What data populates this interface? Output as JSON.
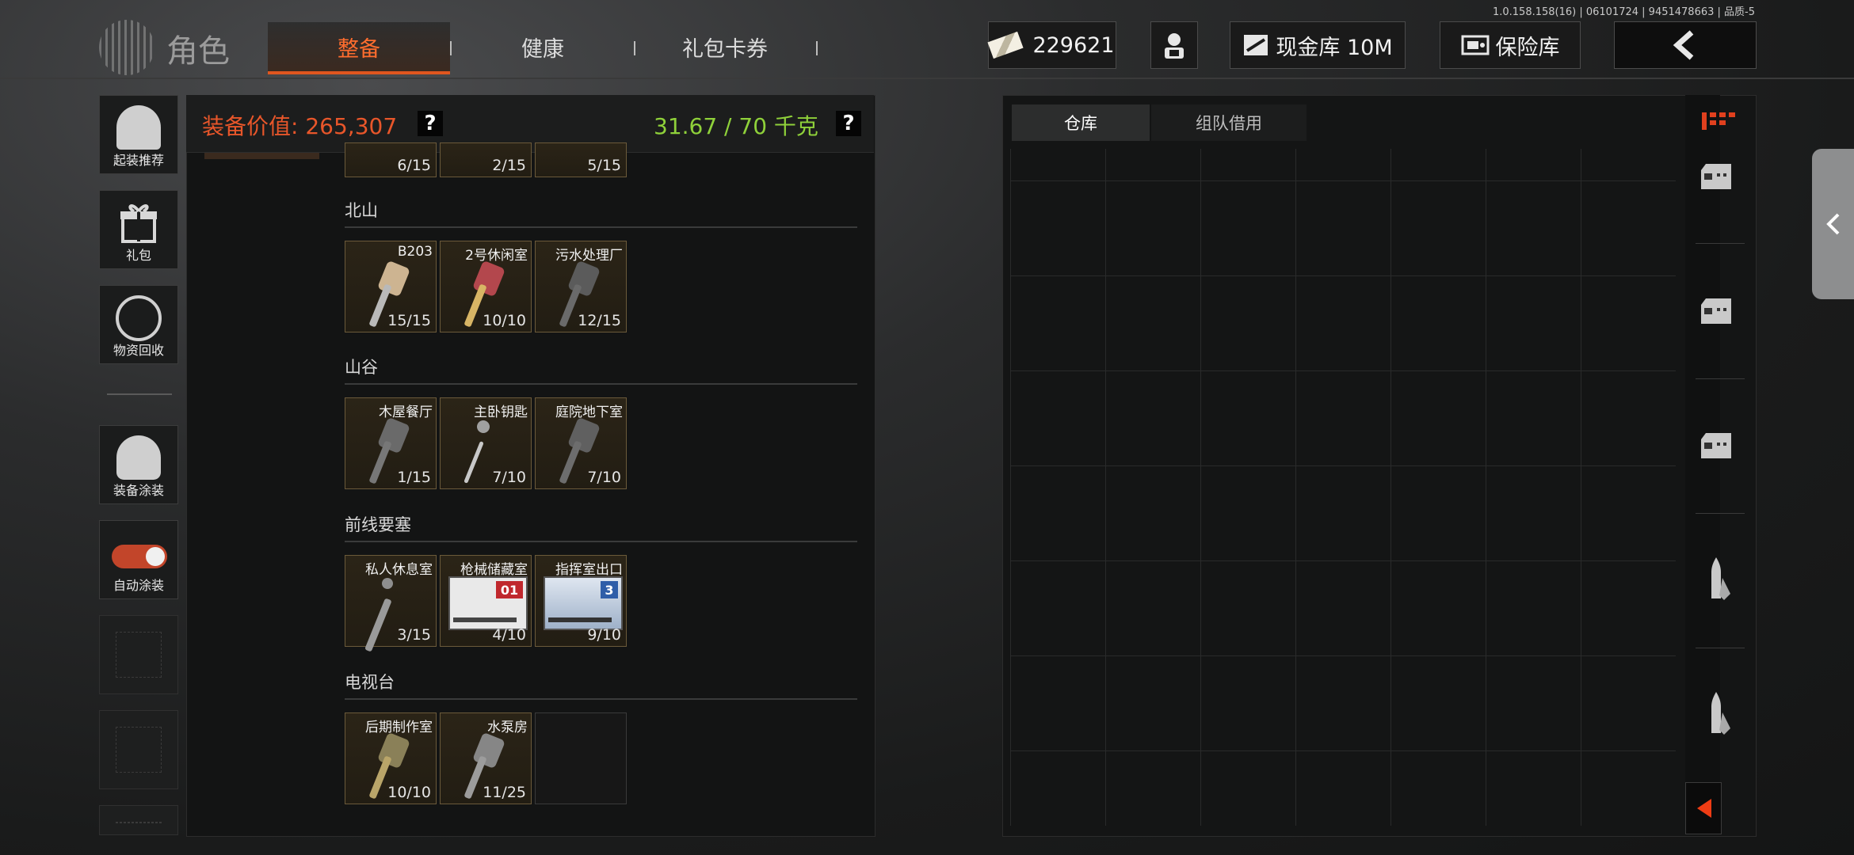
{
  "version_text": "1.0.158.158(16) | 06101724 | 9451478663 | 品质-5",
  "header": {
    "title": "角色",
    "tabs": [
      {
        "label": "整备",
        "active": true
      },
      {
        "label": "健康",
        "active": false
      },
      {
        "label": "礼包卡券",
        "active": false
      }
    ],
    "currency_value": "229621",
    "cash_vault_label": "现金库 10M",
    "safe_label": "保险库",
    "colors": {
      "accent": "#e0561f",
      "weight_green": "#8fd13a"
    }
  },
  "left_nav": {
    "items": [
      {
        "label": "起装推荐",
        "icon": "helmet-grid-icon"
      },
      {
        "label": "礼包",
        "icon": "gift-icon"
      },
      {
        "label": "物资回收",
        "icon": "recycle-icon"
      },
      {
        "label": "装备涂装",
        "icon": "spray-helmet-icon"
      },
      {
        "label": "自动涂装",
        "icon": "toggle-icon",
        "toggle_on": true
      }
    ]
  },
  "equipment": {
    "value_label": "装备价值:",
    "value": "265,307",
    "weight": "31.67 / 70 千克",
    "help": "?"
  },
  "key_sections": [
    {
      "title": "",
      "partial": true,
      "items": [
        {
          "name": "",
          "count": "6/15",
          "kind": "key"
        },
        {
          "name": "",
          "count": "2/15",
          "kind": "key"
        },
        {
          "name": "",
          "count": "5/15",
          "kind": "key"
        }
      ]
    },
    {
      "title": "北山",
      "items": [
        {
          "name": "B203",
          "count": "15/15",
          "kind": "key",
          "color": "#cdb491"
        },
        {
          "name": "2号休闲室",
          "count": "10/10",
          "kind": "key",
          "color": "#c9a562"
        },
        {
          "name": "污水处理厂",
          "count": "12/15",
          "kind": "key",
          "color": "#5b5b5b"
        }
      ]
    },
    {
      "title": "山谷",
      "items": [
        {
          "name": "木屋餐厅",
          "count": "1/15",
          "kind": "key",
          "color": "#6a6a6a"
        },
        {
          "name": "主卧钥匙",
          "count": "7/10",
          "kind": "key",
          "color": "#a0a0a0"
        },
        {
          "name": "庭院地下室",
          "count": "7/10",
          "kind": "key",
          "color": "#606060"
        }
      ]
    },
    {
      "title": "前线要塞",
      "items": [
        {
          "name": "私人休息室",
          "count": "3/15",
          "kind": "key",
          "color": "#8e8e8e"
        },
        {
          "name": "枪械储藏室",
          "count": "4/10",
          "kind": "card",
          "card_text": "01",
          "card_color": "#c0282d"
        },
        {
          "name": "指挥室出口",
          "count": "9/10",
          "kind": "card",
          "card_text": "3",
          "card_color": "#2f5ea8"
        }
      ]
    },
    {
      "title": "电视台",
      "items": [
        {
          "name": "后期制作室",
          "count": "10/10",
          "kind": "key",
          "color": "#8a8058"
        },
        {
          "name": "水泵房",
          "count": "11/25",
          "kind": "key",
          "color": "#868686"
        }
      ]
    }
  ],
  "storage": {
    "tabs": [
      {
        "label": "仓库",
        "active": true
      },
      {
        "label": "组队借用",
        "active": false
      }
    ]
  },
  "right_column_icons": [
    "grid-layout-icon",
    "crate-icon",
    "crate-icon",
    "crate-icon",
    "ammo-icon",
    "ammo-icon",
    "collapse-arrow-icon"
  ]
}
